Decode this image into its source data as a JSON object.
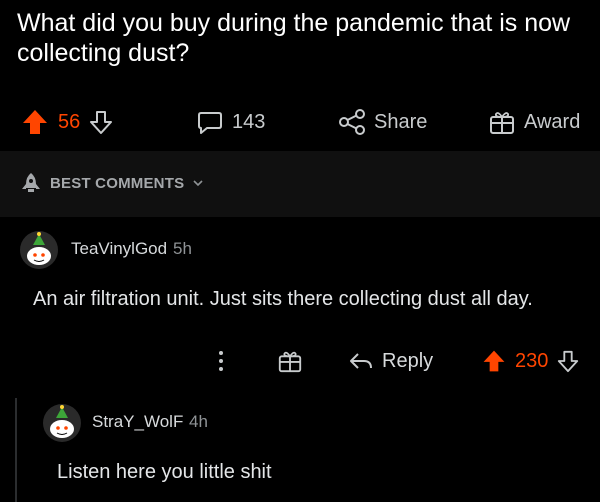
{
  "post": {
    "title": "What did you buy during the pandemic that is now collecting dust?",
    "vote_count": "56",
    "comment_count": "143",
    "share_label": "Share",
    "award_label": "Award"
  },
  "sort": {
    "label": "BEST COMMENTS"
  },
  "comments": [
    {
      "author": "TeaVinylGod",
      "time": "5h",
      "body": "An air filtration unit. Just sits there collecting dust all day.",
      "reply_label": "Reply",
      "vote_count": "230"
    },
    {
      "author": "StraY_WolF",
      "time": "4h",
      "body": "Listen here you little shit"
    }
  ],
  "colors": {
    "background": "#000000",
    "upvote_orange": "#ff4500",
    "text": "#d7dadc",
    "muted": "#8f9396",
    "sort_bar": "#101010"
  },
  "icons": [
    "upvote-icon",
    "downvote-icon",
    "comment-bubble-icon",
    "share-icon",
    "award-icon",
    "rocket-icon",
    "chevron-down-icon",
    "avatar-snoo-icon",
    "more-options-icon",
    "reply-arrow-icon"
  ]
}
